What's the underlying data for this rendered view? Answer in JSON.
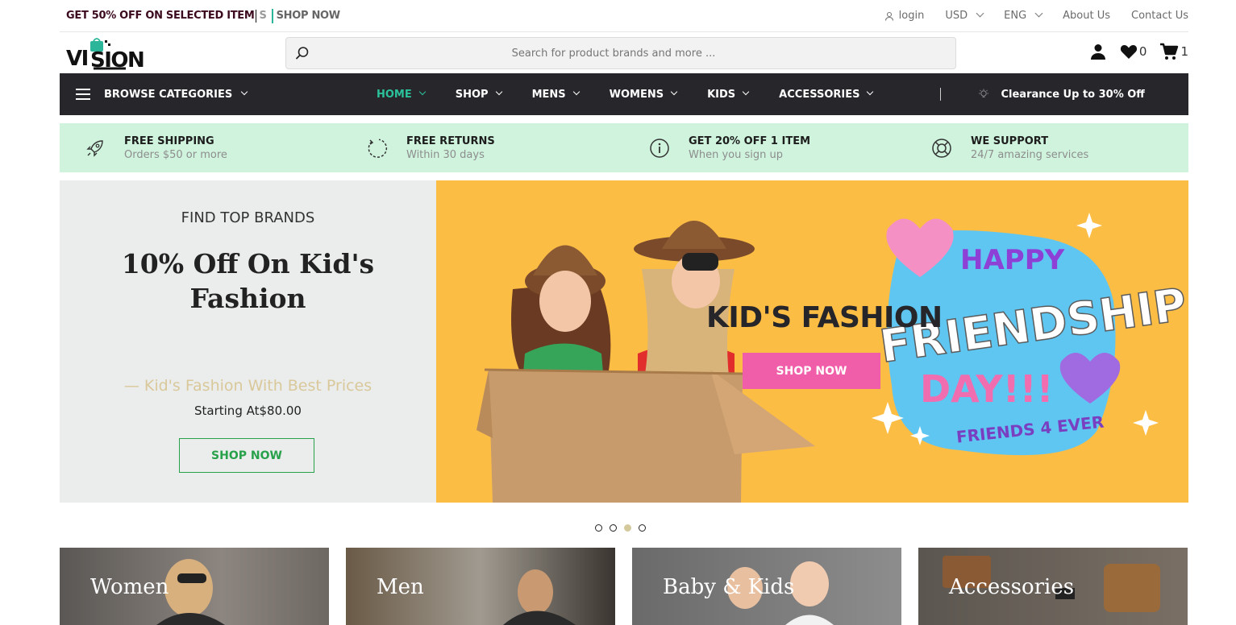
{
  "topbar": {
    "promo_main": "GET 50% OFF ON SELECTED ITEM",
    "promo_tail": "S",
    "promo_link": "SHOP NOW",
    "login": "login",
    "currency": "USD",
    "language": "ENG",
    "about": "About Us",
    "contact": "Contact Us"
  },
  "header": {
    "logo_text": "VISION",
    "search_placeholder": "Search for product brands and more ...",
    "wishlist_count": "0",
    "cart_count": "1"
  },
  "nav": {
    "browse_label": "BROWSE CATEGORIES",
    "items": [
      {
        "label": "HOME",
        "active": true
      },
      {
        "label": "SHOP"
      },
      {
        "label": "MENS"
      },
      {
        "label": "WOMENS"
      },
      {
        "label": "KIDS"
      },
      {
        "label": "ACCESSORIES"
      }
    ],
    "clearance": "Clearance Up to 30% Off"
  },
  "features": [
    {
      "icon": "rocket-icon",
      "title": "FREE SHIPPING",
      "subtitle": "Orders $50 or more"
    },
    {
      "icon": "refresh-icon",
      "title": "FREE RETURNS",
      "subtitle": "Within 30 days"
    },
    {
      "icon": "info-icon",
      "title": "GET 20% OFF 1 ITEM",
      "subtitle": "When you sign up"
    },
    {
      "icon": "lifebuoy-icon",
      "title": "WE SUPPORT",
      "subtitle": "24/7 amazing services"
    }
  ],
  "hero": {
    "kicker": "FIND TOP BRANDS",
    "headline": "10% Off On Kid's Fashion",
    "tagline": "— Kid's Fashion With Best Prices",
    "price": "Starting At$80.00",
    "left_button": "SHOP NOW",
    "banner_title": "KID'S FASHION",
    "banner_button": "SHOP NOW",
    "sticker_lines": [
      "HAPPY",
      "FRIENDSHIP",
      "DAY!!!",
      "FRIENDS 4 EVER"
    ]
  },
  "slider": {
    "count": 4,
    "active_index": 2
  },
  "categories": [
    {
      "label": "Women"
    },
    {
      "label": "Men"
    },
    {
      "label": "Baby & Kids"
    },
    {
      "label": "Accessories"
    }
  ],
  "colors": {
    "accent": "#2bc29b",
    "nav_bg": "#27262b",
    "feature_bg": "#cff3dd",
    "hero_right_bg": "#fcbd45",
    "pink_button": "#f05da8",
    "green_button": "#27a14a"
  }
}
